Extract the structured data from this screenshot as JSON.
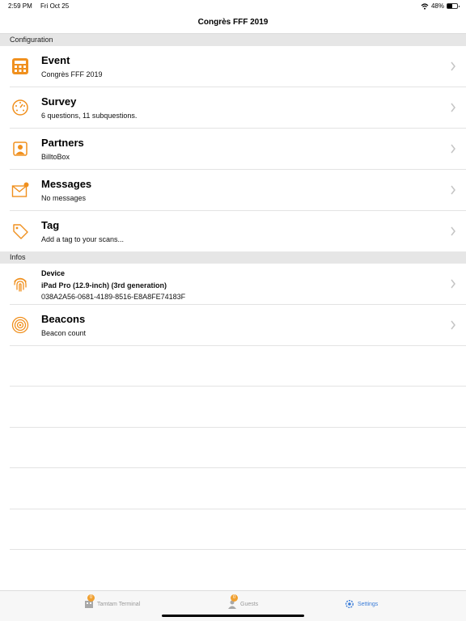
{
  "status_bar": {
    "time": "2:59 PM",
    "date": "Fri Oct 25",
    "battery": "48%",
    "battery_level": 0.48
  },
  "nav": {
    "title": "Congrès FFF 2019"
  },
  "sections": {
    "configuration": "Configuration",
    "infos": "Infos"
  },
  "rows": {
    "event": {
      "title": "Event",
      "subtitle": "Congrès FFF 2019",
      "icon": "calculator-icon"
    },
    "survey": {
      "title": "Survey",
      "subtitle": "6 questions, 11 subquestions.",
      "icon": "dial-icon"
    },
    "partners": {
      "title": "Partners",
      "subtitle": "BilltoBox",
      "icon": "contact-icon"
    },
    "messages": {
      "title": "Messages",
      "subtitle": "No messages",
      "icon": "envelope-icon"
    },
    "tag": {
      "title": "Tag",
      "subtitle": "Add a tag to your scans...",
      "icon": "tag-icon"
    },
    "device": {
      "title": "Device",
      "subtitle": "iPad Pro (12.9-inch) (3rd generation)",
      "subtitle2": "038A2A56-0681-4189-8516-E8A8FE74183F",
      "icon": "fingerprint-icon"
    },
    "beacons": {
      "title": "Beacons",
      "subtitle": "Beacon count",
      "icon": "beacon-icon"
    }
  },
  "tabs": {
    "terminal": {
      "label": "Tamtam Terminal",
      "badge": "0"
    },
    "guests": {
      "label": "Guests",
      "badge": "0"
    },
    "settings": {
      "label": "Settings"
    }
  },
  "colors": {
    "accent": "#f0901e",
    "active_tab": "#3b7dd8",
    "section_bg": "#e6e6e6"
  }
}
